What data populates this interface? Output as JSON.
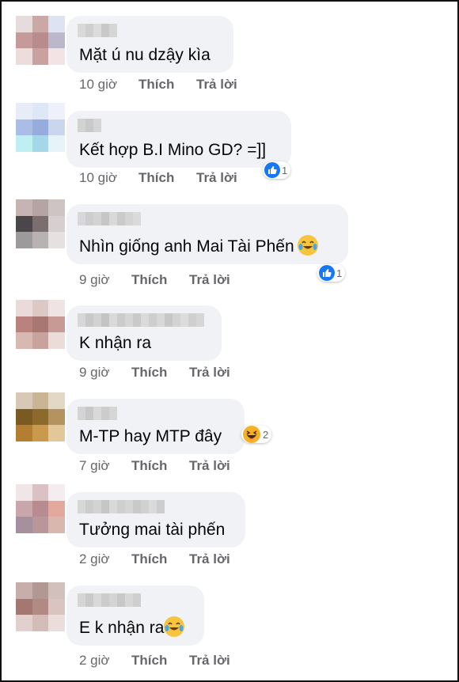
{
  "comments": [
    {
      "text": "Mặt ú nu dzậy kìa",
      "time": "10 giờ",
      "like": "Thích",
      "reply": "Trả lời",
      "reaction_count": ""
    },
    {
      "text": "Kết hợp B.I Mino GD? =]]",
      "time": "10 giờ",
      "like": "Thích",
      "reply": "Trả lời",
      "reaction_count": "1"
    },
    {
      "text": "Nhìn giống anh Mai Tài Phến",
      "time": "9 giờ",
      "like": "Thích",
      "reply": "Trả lời",
      "reaction_count": "1"
    },
    {
      "text": "K nhận ra",
      "time": "9 giờ",
      "like": "Thích",
      "reply": "Trả lời",
      "reaction_count": ""
    },
    {
      "text": "M-TP hay MTP đây",
      "time": "7 giờ",
      "like": "Thích",
      "reply": "Trả lời",
      "reaction_count": "2"
    },
    {
      "text": "Tưởng mai tài phến",
      "time": "2 giờ",
      "like": "Thích",
      "reply": "Trả lời",
      "reaction_count": ""
    },
    {
      "text": "E k nhận ra",
      "time": "2 giờ",
      "like": "Thích",
      "reply": "Trả lời",
      "reaction_count": ""
    }
  ],
  "reaction_icons": [
    "like-icon",
    "like-icon",
    "haha-icon"
  ],
  "colors": {
    "bubble": "#f0f2f5",
    "meta_text": "#65676b",
    "like_blue": "#1877f2",
    "emoji_yellow": "#f7c53d"
  }
}
